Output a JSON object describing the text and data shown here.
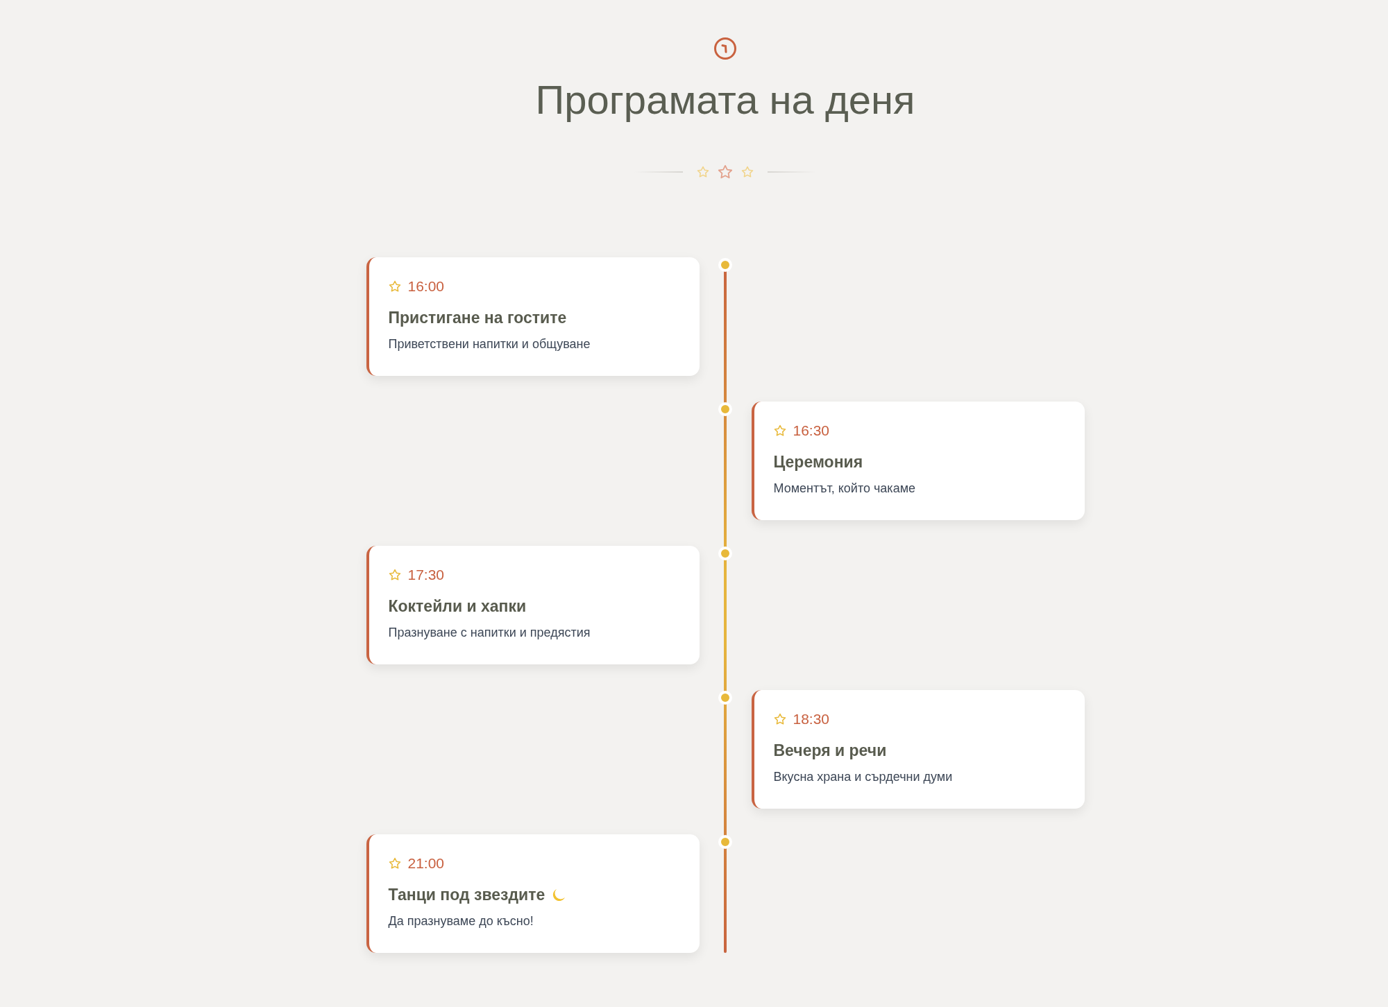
{
  "header": {
    "title": "Програмата на деня"
  },
  "events": [
    {
      "time": "16:00",
      "title": "Пристигане на гостите",
      "description": "Приветствени напитки и общуване",
      "kind": "plain"
    },
    {
      "time": "16:30",
      "title": "Церемония",
      "description": "Моментът, който чакаме",
      "kind": "plain"
    },
    {
      "time": "17:30",
      "title": "Коктейли и хапки",
      "description": "Празнуване с напитки и предястия",
      "kind": "plain"
    },
    {
      "time": "18:30",
      "title": "Вечеря и речи",
      "description": "Вкусна храна и сърдечни думи",
      "kind": "plain"
    },
    {
      "time": "21:00",
      "title": "Танци под звездите",
      "description": "Да празнуваме до късно!",
      "kind": "night"
    }
  ]
}
